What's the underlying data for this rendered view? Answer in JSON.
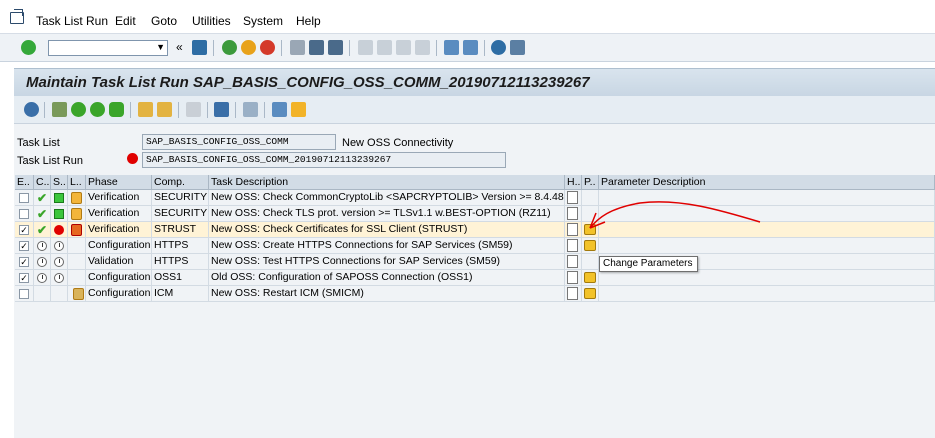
{
  "menu": [
    "Task List Run",
    "Edit",
    "Goto",
    "Utilities",
    "System",
    "Help"
  ],
  "title": "Maintain Task List Run SAP_BASIS_CONFIG_OSS_COMM_20190712113239267",
  "header": {
    "task_list_label": "Task List",
    "task_list_value": "SAP_BASIS_CONFIG_OSS_COMM",
    "task_list_desc": "New OSS Connectivity",
    "task_list_run_label": "Task List Run",
    "task_list_run_value": "SAP_BASIS_CONFIG_OSS_COMM_20190712113239267"
  },
  "columns": [
    "E..",
    "C..",
    "S..",
    "L..",
    "Phase",
    "Comp.",
    "Task Description",
    "H..",
    "P..",
    "Parameter Description"
  ],
  "rows": [
    {
      "checked": false,
      "c": "tick",
      "s": "green",
      "l": "log",
      "phase": "Verification",
      "comp": "SECURITY",
      "desc": "New OSS: Check CommonCryptoLib <SAPCRYPTOLIB> Version >= 8.4.48",
      "h": "doc",
      "p": ""
    },
    {
      "checked": false,
      "c": "tick",
      "s": "green",
      "l": "log",
      "phase": "Verification",
      "comp": "SECURITY",
      "desc": "New OSS: Check TLS prot. version >= TLSv1.1 w.BEST-OPTION (RZ11)",
      "h": "doc",
      "p": ""
    },
    {
      "checked": true,
      "c": "tick",
      "s": "red",
      "l": "log-error",
      "phase": "Verification",
      "comp": "STRUST",
      "desc": "New OSS: Check Certificates for SSL Client (STRUST)",
      "h": "doc",
      "p": "pencil",
      "highlight": true
    },
    {
      "checked": true,
      "c": "clock",
      "s": "clock",
      "l": "",
      "phase": "Configuration",
      "comp": "HTTPS",
      "desc": "New OSS: Create HTTPS Connections for SAP Services (SM59)",
      "h": "doc",
      "p": "pencil"
    },
    {
      "checked": true,
      "c": "clock",
      "s": "clock",
      "l": "",
      "phase": "Validation",
      "comp": "HTTPS",
      "desc": "New OSS: Test HTTPS Connections for SAP Services (SM59)",
      "h": "doc",
      "p": ""
    },
    {
      "checked": true,
      "c": "clock",
      "s": "clock",
      "l": "",
      "phase": "Configuration",
      "comp": "OSS1",
      "desc": "Old OSS: Configuration of SAPOSS Connection (OSS1)",
      "h": "doc",
      "p": "pencil"
    },
    {
      "checked": false,
      "c": "",
      "s": "",
      "l": "tool",
      "phase": "Configuration",
      "comp": "ICM",
      "desc": "New OSS: Restart ICM  (SMICM)",
      "h": "doc",
      "p": "pencil"
    }
  ],
  "tooltip": "Change Parameters",
  "colors": {
    "highlight_row": "#fff3d6",
    "annotation": "#e00000"
  }
}
